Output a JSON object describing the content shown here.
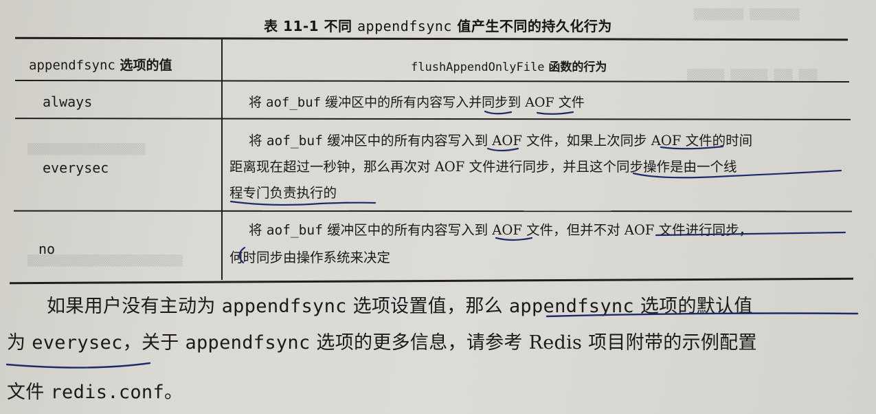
{
  "table": {
    "caption_prefix": "表 11-1 不同 ",
    "caption_code": "appendfsync",
    "caption_suffix": " 值产生不同的持久化行为",
    "header": {
      "col1_code": "appendfsync",
      "col1_text": " 选项的值",
      "col2_code": "flushAppendOnlyFile",
      "col2_text": " 函数的行为"
    },
    "rows": [
      {
        "option": "always",
        "lines": [
          {
            "pre": "将 ",
            "code": "aof_buf",
            "post": " 缓冲区中的所有内容写入并同步到 AOF 文件"
          }
        ]
      },
      {
        "option": "everysec",
        "lines": [
          {
            "pre": "将 ",
            "code": "aof_buf",
            "post": " 缓冲区中的所有内容写入到 AOF 文件，如果上次同步 AOF 文件的时间"
          },
          {
            "pre": "",
            "code": "",
            "post": "距离现在超过一秒钟，那么再次对 AOF 文件进行同步，并且这个同步操作是由一个线"
          },
          {
            "pre": "",
            "code": "",
            "post": "程专门负责执行的"
          }
        ]
      },
      {
        "option": "no",
        "lines": [
          {
            "pre": "将 ",
            "code": "aof_buf",
            "post": " 缓冲区中的所有内容写入到 AOF 文件，但并不对 AOF 文件进行同步，"
          },
          {
            "pre": "",
            "code": "",
            "post": "何时同步由操作系统来决定"
          }
        ]
      }
    ]
  },
  "paragraph": {
    "line1_a": "如果用户没有主动为 ",
    "line1_b": "appendfsync",
    "line1_c": " 选项设置值，那么 ",
    "line1_d": "appendfsync",
    "line1_e": " 选项的默认值",
    "line2_a": "为 ",
    "line2_b": "everysec",
    "line2_c": "，关于 ",
    "line2_d": "appendfsync",
    "line2_e": " 选项的更多信息，请参考 Redis 项目附带的示例配置",
    "line3_a": "文件 ",
    "line3_b": "redis.conf",
    "line3_c": "。"
  },
  "colors": {
    "paper": "#d8d7d2",
    "ink_text": "#1a1a1a",
    "pen_blue": "#1d2a6b"
  }
}
